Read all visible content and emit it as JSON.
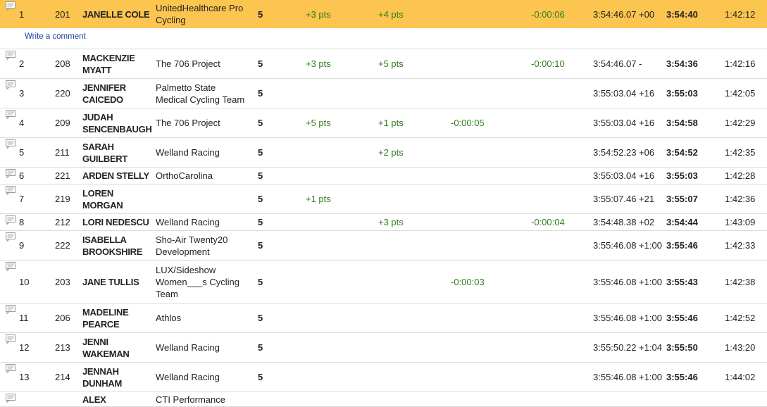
{
  "rows": [
    {
      "place": "1",
      "bib": "201",
      "name": [
        "JANELLE COLE"
      ],
      "team": [
        "UnitedHealthcare Pro",
        "Cycling"
      ],
      "laps": "5",
      "p1": "+3 pts",
      "p2": "+4 pts",
      "t1": "",
      "t2": "-0:00:06",
      "time": "3:54:46.07 +00",
      "final": "3:54:40",
      "gap": "1:42:12"
    },
    {
      "place": "2",
      "bib": "208",
      "name": [
        "MACKENZIE",
        "MYATT"
      ],
      "team": [
        "The 706 Project"
      ],
      "laps": "5",
      "p1": "+3 pts",
      "p2": "+5 pts",
      "t1": "",
      "t2": "-0:00:10",
      "time": "3:54:46.07 -",
      "final": "3:54:36",
      "gap": "1:42:16"
    },
    {
      "place": "3",
      "bib": "220",
      "name": [
        "JENNIFER",
        "CAICEDO"
      ],
      "team": [
        "Palmetto State",
        "Medical Cycling Team"
      ],
      "laps": "5",
      "p1": "",
      "p2": "",
      "t1": "",
      "t2": "",
      "time": "3:55:03.04 +16",
      "final": "3:55:03",
      "gap": "1:42:05"
    },
    {
      "place": "4",
      "bib": "209",
      "name": [
        "JUDAH",
        "SENCENBAUGH"
      ],
      "team": [
        "The 706 Project"
      ],
      "laps": "5",
      "p1": "+5 pts",
      "p2": "+1 pts",
      "t1": "-0:00:05",
      "t2": "",
      "time": "3:55:03.04 +16",
      "final": "3:54:58",
      "gap": "1:42:29"
    },
    {
      "place": "5",
      "bib": "211",
      "name": [
        "SARAH",
        "GUILBERT"
      ],
      "team": [
        "Welland Racing"
      ],
      "laps": "5",
      "p1": "",
      "p2": "+2 pts",
      "t1": "",
      "t2": "",
      "time": "3:54:52.23 +06",
      "final": "3:54:52",
      "gap": "1:42:35"
    },
    {
      "place": "6",
      "bib": "221",
      "name": [
        "ARDEN STELLY"
      ],
      "team": [
        "OrthoCarolina"
      ],
      "laps": "5",
      "p1": "",
      "p2": "",
      "t1": "",
      "t2": "",
      "time": "3:55:03.04 +16",
      "final": "3:55:03",
      "gap": "1:42:28"
    },
    {
      "place": "7",
      "bib": "219",
      "name": [
        "LOREN",
        "MORGAN"
      ],
      "team": [
        ""
      ],
      "laps": "5",
      "p1": "+1 pts",
      "p2": "",
      "t1": "",
      "t2": "",
      "time": "3:55:07.46 +21",
      "final": "3:55:07",
      "gap": "1:42:36"
    },
    {
      "place": "8",
      "bib": "212",
      "name": [
        "LORI NEDESCU"
      ],
      "team": [
        "Welland Racing"
      ],
      "laps": "5",
      "p1": "",
      "p2": "+3 pts",
      "t1": "",
      "t2": "-0:00:04",
      "time": "3:54:48.38 +02",
      "final": "3:54:44",
      "gap": "1:43:09"
    },
    {
      "place": "9",
      "bib": "222",
      "name": [
        "ISABELLA",
        "BROOKSHIRE"
      ],
      "team": [
        "Sho-Air Twenty20",
        "Development"
      ],
      "laps": "5",
      "p1": "",
      "p2": "",
      "t1": "",
      "t2": "",
      "time": "3:55:46.08 +1:00",
      "final": "3:55:46",
      "gap": "1:42:33"
    },
    {
      "place": "10",
      "bib": "203",
      "name": [
        "JANE TULLIS"
      ],
      "team": [
        "LUX/Sideshow",
        "Women___s Cycling",
        "Team"
      ],
      "laps": "5",
      "p1": "",
      "p2": "",
      "t1": "-0:00:03",
      "t2": "",
      "time": "3:55:46.08 +1:00",
      "final": "3:55:43",
      "gap": "1:42:38"
    },
    {
      "place": "11",
      "bib": "206",
      "name": [
        "MADELINE",
        "PEARCE"
      ],
      "team": [
        "Athlos"
      ],
      "laps": "5",
      "p1": "",
      "p2": "",
      "t1": "",
      "t2": "",
      "time": "3:55:46.08 +1:00",
      "final": "3:55:46",
      "gap": "1:42:52"
    },
    {
      "place": "12",
      "bib": "213",
      "name": [
        "JENNI",
        "WAKEMAN"
      ],
      "team": [
        "Welland Racing"
      ],
      "laps": "5",
      "p1": "",
      "p2": "",
      "t1": "",
      "t2": "",
      "time": "3:55:50.22 +1:04",
      "final": "3:55:50",
      "gap": "1:43:20"
    },
    {
      "place": "13",
      "bib": "214",
      "name": [
        "JENNAH",
        "DUNHAM"
      ],
      "team": [
        "Welland Racing"
      ],
      "laps": "5",
      "p1": "",
      "p2": "",
      "t1": "",
      "t2": "",
      "time": "3:55:46.08 +1:00",
      "final": "3:55:46",
      "gap": "1:44:02"
    },
    {
      "place": "",
      "bib": "",
      "name": [
        "ALEX"
      ],
      "team": [
        "CTI Performance"
      ],
      "laps": "",
      "p1": "",
      "p2": "",
      "t1": "",
      "t2": "",
      "time": "",
      "final": "",
      "gap": ""
    }
  ],
  "comment_link": "Write a comment",
  "colors": {
    "highlight": "#fcc54f",
    "points": "#2e7d1d",
    "link": "#1a3fa0"
  },
  "icons": {
    "row": "comment-icon"
  }
}
